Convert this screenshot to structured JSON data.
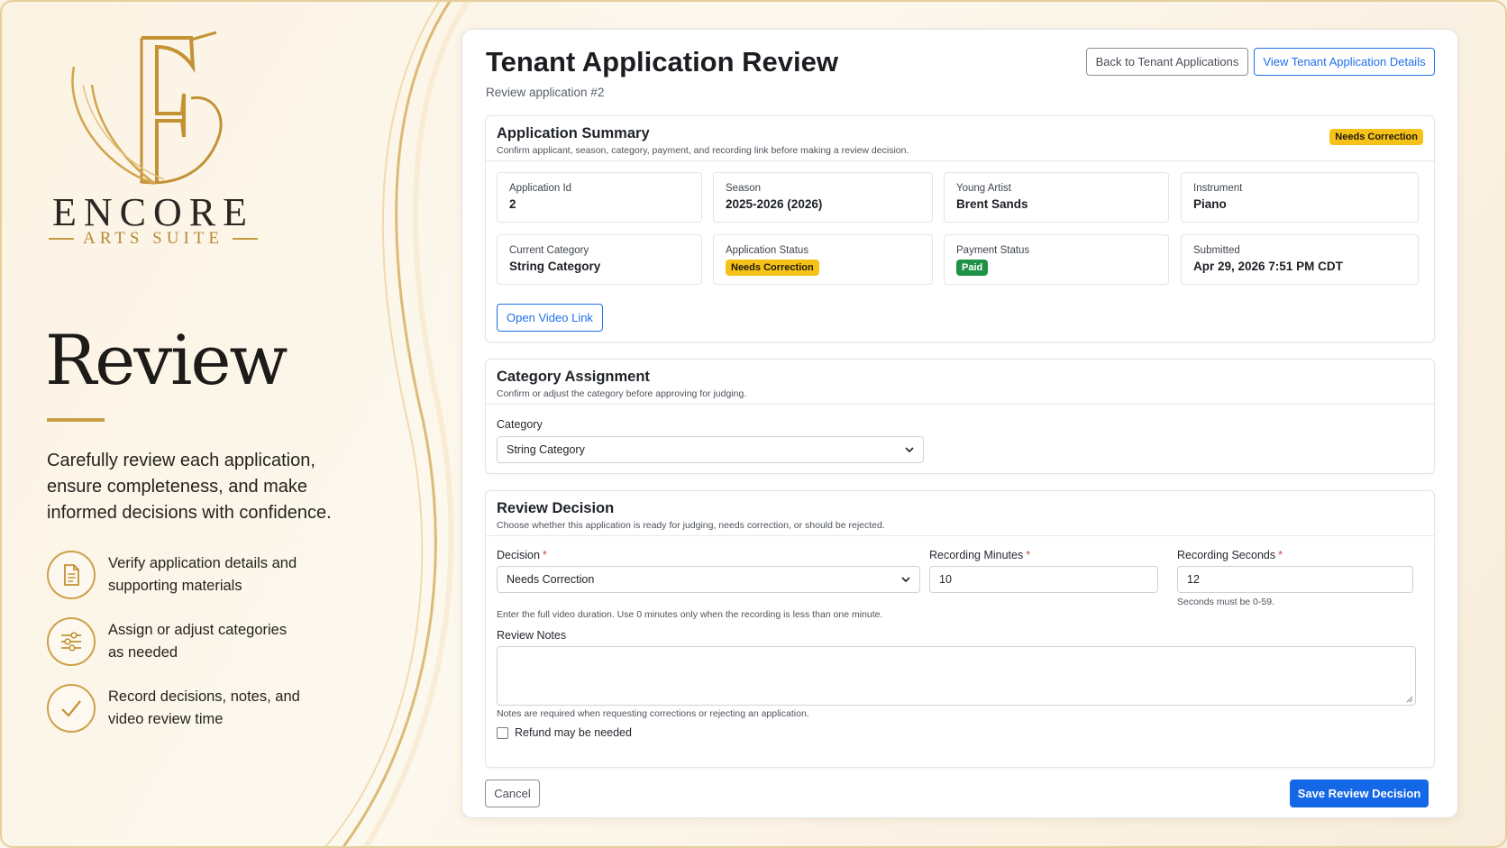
{
  "brand": {
    "name": "ENCORE",
    "tagline": "ARTS SUITE"
  },
  "hero": {
    "title": "Review",
    "description": "Carefully review each application, ensure completeness, and make informed decisions with confidence.",
    "features": [
      {
        "icon": "document-icon",
        "text": "Verify application details and supporting materials"
      },
      {
        "icon": "sliders-icon",
        "text": "Assign or adjust categories as needed"
      },
      {
        "icon": "checkmark-icon",
        "text": "Record decisions, notes, and video review time"
      }
    ]
  },
  "header": {
    "title": "Tenant Application Review",
    "subtitle": "Review application #2",
    "back_label": "Back to Tenant Applications",
    "view_label": "View Tenant Application Details"
  },
  "summary": {
    "title": "Application Summary",
    "description": "Confirm applicant, season, category, payment, and recording link before making a review decision.",
    "status_badge": "Needs Correction",
    "fields": {
      "application_id": {
        "label": "Application Id",
        "value": "2"
      },
      "season": {
        "label": "Season",
        "value": "2025-2026 (2026)"
      },
      "young_artist": {
        "label": "Young Artist",
        "value": "Brent Sands"
      },
      "instrument": {
        "label": "Instrument",
        "value": "Piano"
      },
      "current_category": {
        "label": "Current Category",
        "value": "String Category"
      },
      "application_status": {
        "label": "Application Status",
        "value": "Needs Correction"
      },
      "payment_status": {
        "label": "Payment Status",
        "value": "Paid"
      },
      "submitted": {
        "label": "Submitted",
        "value": "Apr 29, 2026 7:51 PM CDT"
      }
    },
    "video_button": "Open Video Link"
  },
  "category": {
    "title": "Category Assignment",
    "description": "Confirm or adjust the category before approving for judging.",
    "field_label": "Category",
    "selected": "String Category"
  },
  "decision": {
    "title": "Review Decision",
    "description": "Choose whether this application is ready for judging, needs correction, or should be rejected.",
    "decision_label": "Decision",
    "decision_value": "Needs Correction",
    "minutes_label": "Recording Minutes",
    "minutes_value": "10",
    "seconds_label": "Recording Seconds",
    "seconds_value": "12",
    "seconds_help": "Seconds must be 0-59.",
    "duration_help": "Enter the full video duration. Use 0 minutes only when the recording is less than one minute.",
    "notes_label": "Review Notes",
    "notes_value": "",
    "notes_help": "Notes are required when requesting corrections or rejecting an application.",
    "refund_label": "Refund may be needed",
    "required_mark": "*"
  },
  "footer": {
    "cancel_label": "Cancel",
    "save_label": "Save Review Decision"
  },
  "colors": {
    "accent": "#1467e6",
    "gold": "#c99c46",
    "warning": "#f6c21a",
    "success": "#1e9247"
  }
}
